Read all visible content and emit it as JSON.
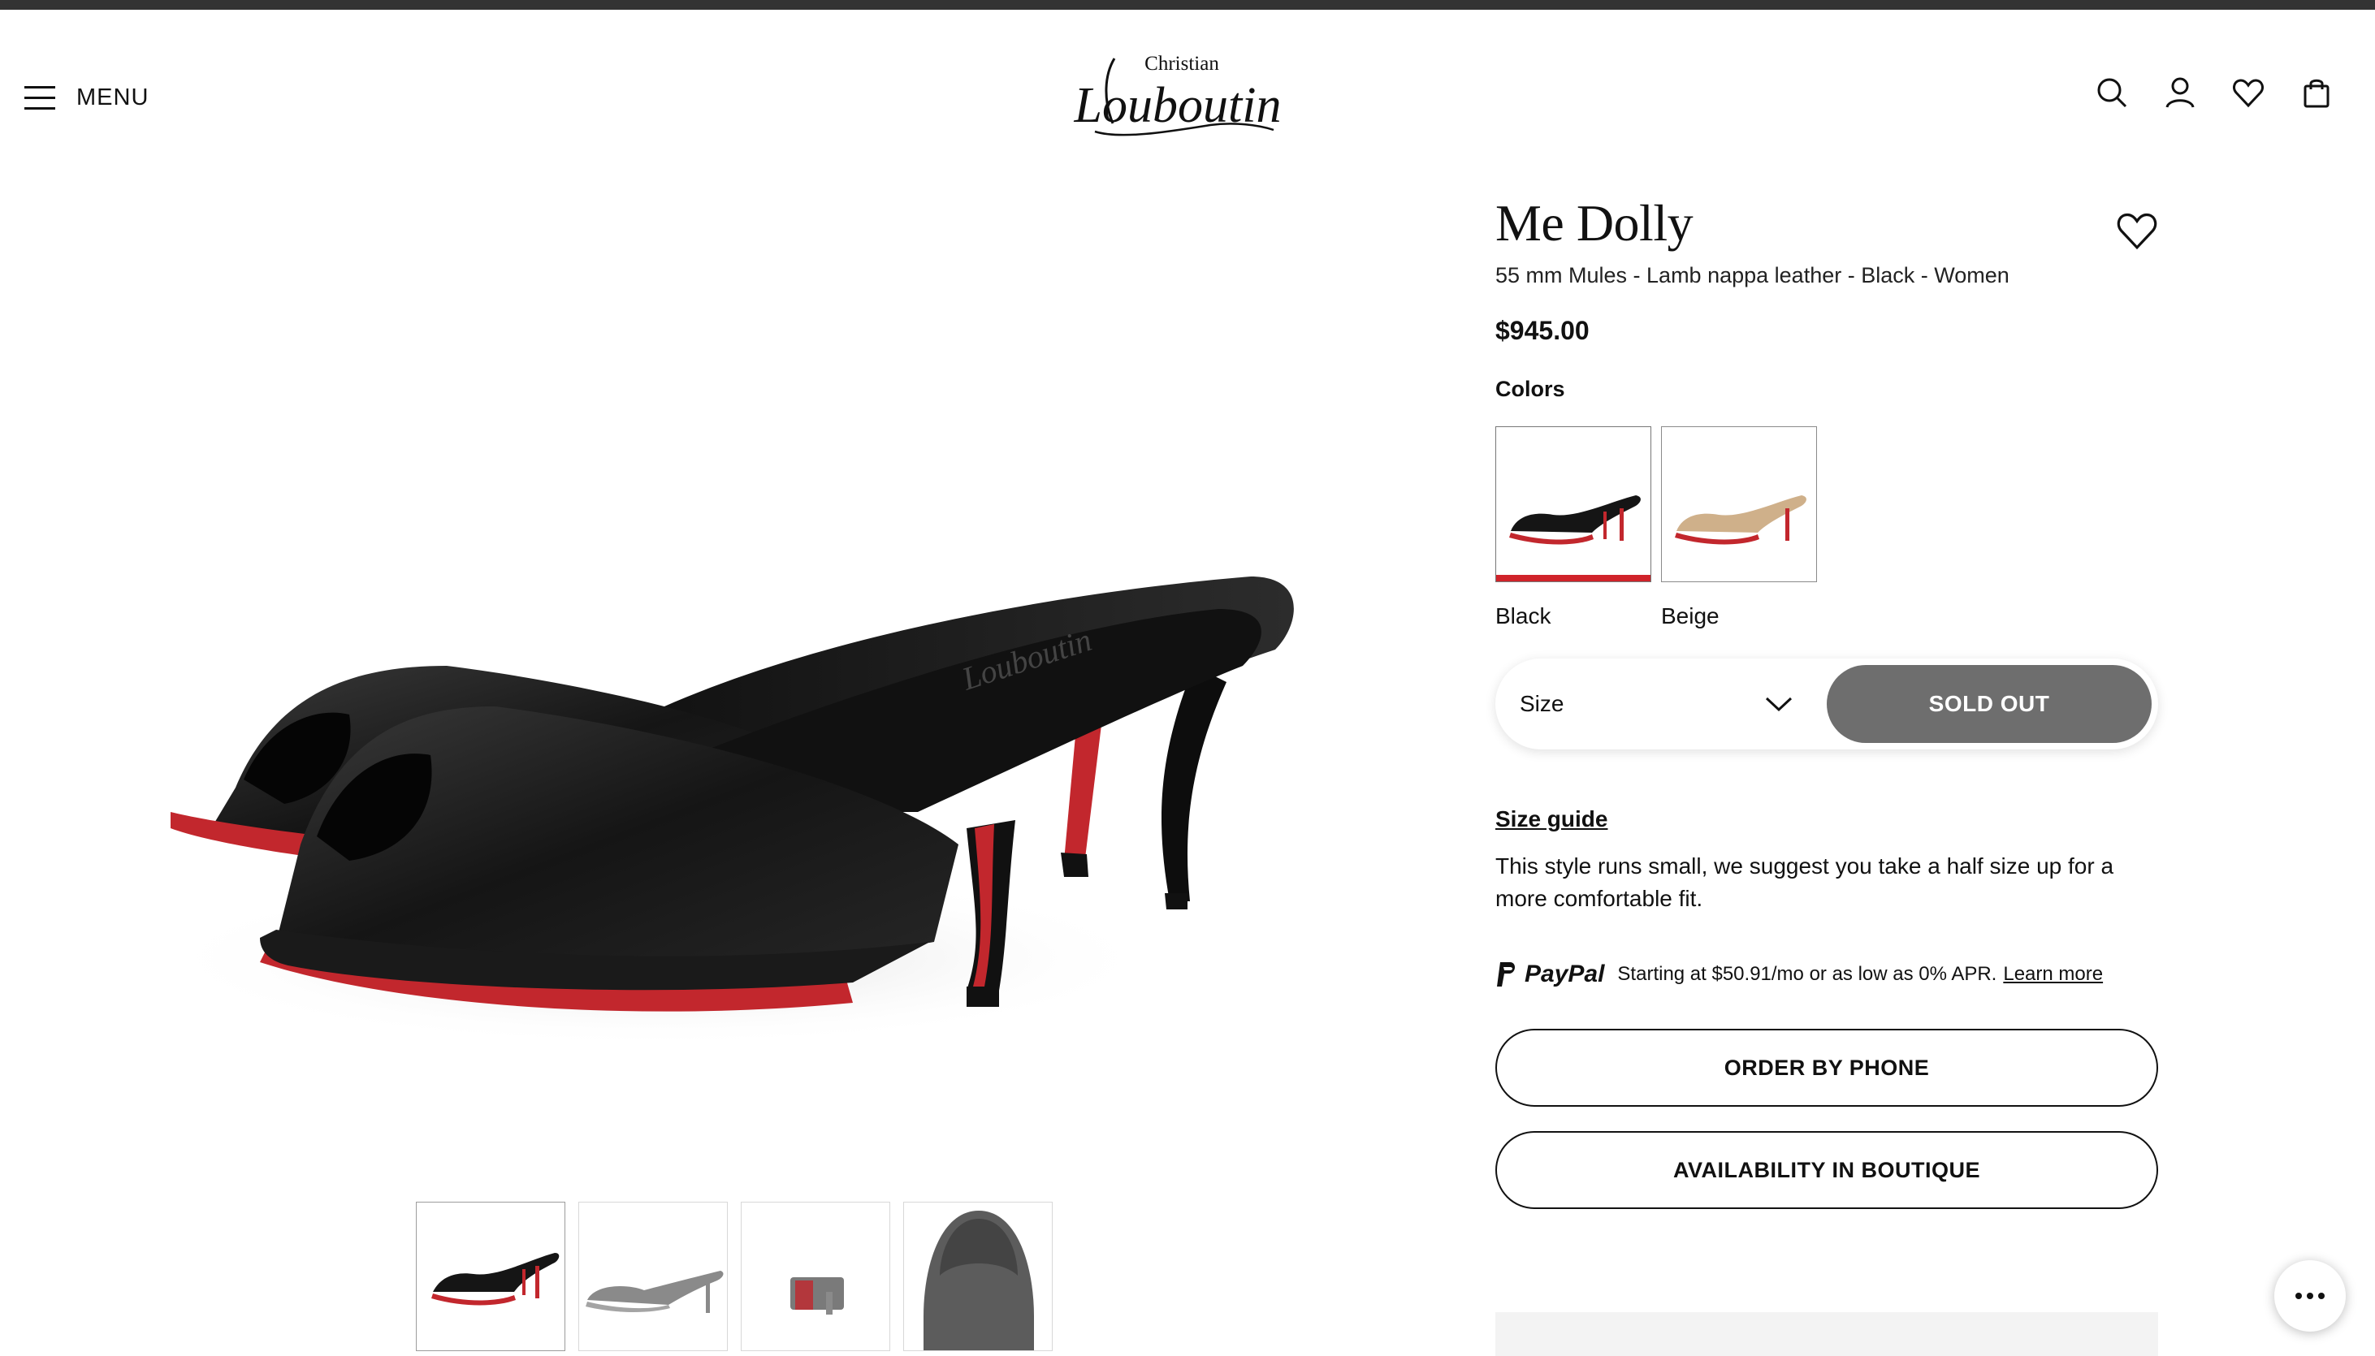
{
  "header": {
    "menu_label": "MENU",
    "brand_top": "Christian",
    "brand_main": "Louboutin",
    "icons": [
      "search-icon",
      "account-icon",
      "wishlist-icon",
      "bag-icon"
    ]
  },
  "gallery": {
    "thumbnails": [
      "black-side-view",
      "beige-side-view",
      "back-view",
      "top-view"
    ]
  },
  "product": {
    "title": "Me Dolly",
    "subtitle": "55 mm Mules - Lamb nappa leather - Black - Women",
    "price": "$945.00",
    "colors_label": "Colors",
    "colors": [
      {
        "name": "Black",
        "selected": true
      },
      {
        "name": "Beige",
        "selected": false
      }
    ],
    "size_label": "Size",
    "sold_out_label": "SOLD OUT",
    "size_guide_label": "Size guide",
    "fit_note": "This style runs small, we suggest you take a half size up for a more comfortable fit.",
    "paypal": {
      "brand": "PayPal",
      "text": "Starting at $50.91/mo or as low as 0% APR.",
      "link": "Learn more"
    },
    "order_phone_label": "ORDER BY PHONE",
    "availability_label": "AVAILABILITY IN BOUTIQUE"
  },
  "colors": {
    "sole_red": "#d0232a",
    "sold_out_bg": "#6e6e6e",
    "topbar": "#333333"
  }
}
